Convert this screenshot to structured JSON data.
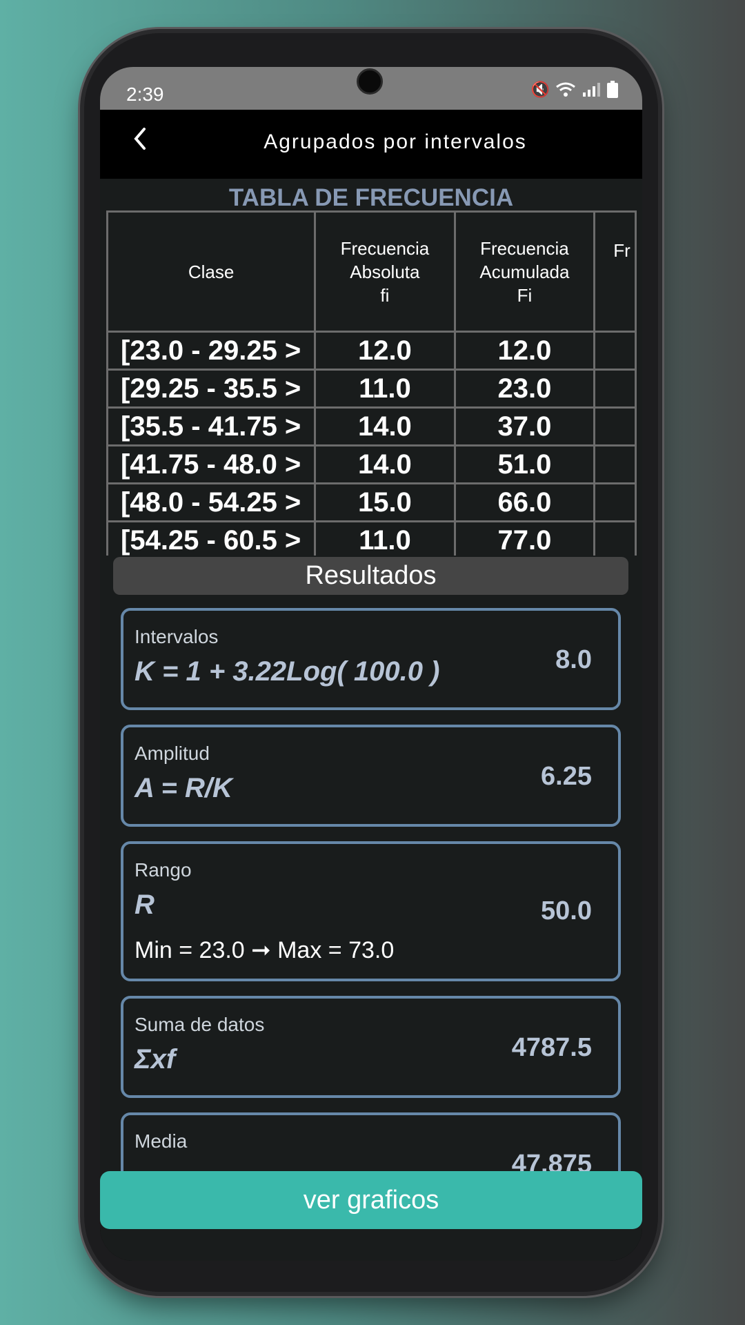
{
  "status": {
    "time": "2:39"
  },
  "appbar": {
    "back_icon": "chevron-left-icon",
    "title": "Agrupados por intervalos"
  },
  "table": {
    "title": "TABLA DE FRECUENCIA",
    "headers": [
      [
        "Clase"
      ],
      [
        "Frecuencia",
        "Absoluta",
        "fi"
      ],
      [
        "Frecuencia",
        "Acumulada",
        "Fi"
      ],
      [
        "Fr"
      ]
    ],
    "rows": [
      [
        "[23.0 - 29.25 >",
        "12.0",
        "12.0"
      ],
      [
        "[29.25 - 35.5 >",
        "11.0",
        "23.0"
      ],
      [
        "[35.5 - 41.75 >",
        "14.0",
        "37.0"
      ],
      [
        "[41.75 - 48.0 >",
        "14.0",
        "51.0"
      ],
      [
        "[48.0 - 54.25 >",
        "15.0",
        "66.0"
      ],
      [
        "[54.25 - 60.5 >",
        "11.0",
        "77.0"
      ]
    ]
  },
  "results": {
    "heading": "Resultados",
    "intervalos": {
      "label": "Intervalos",
      "formula": "K = 1 + 3.22Log( 100.0 )",
      "value": "8.0"
    },
    "amplitud": {
      "label": "Amplitud",
      "formula": "A = R/K",
      "value": "6.25"
    },
    "rango": {
      "label": "Rango",
      "formula": "R",
      "value": "50.0",
      "extra": "Min = 23.0 ➞ Max = 73.0"
    },
    "suma": {
      "label": "Suma de datos",
      "formula": "Σxf",
      "value": "4787.5"
    },
    "media": {
      "label": "Media",
      "value": "47.875"
    }
  },
  "footer": {
    "button_label": "ver graficos"
  },
  "colors": {
    "accent": "#3ab9ab",
    "card_border": "#6688a9",
    "table_title": "#8799b4"
  }
}
